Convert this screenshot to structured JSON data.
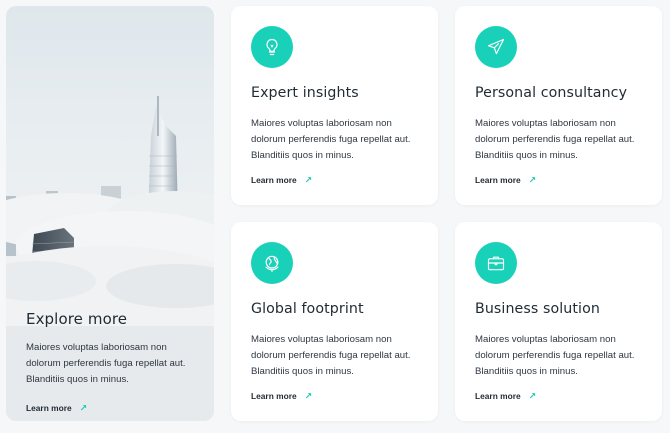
{
  "hero": {
    "title": "Explore more",
    "body": "Maiores voluptas laboriosam non dolorum perferendis fuga repellat aut. Blanditiis quos in minus.",
    "link": "Learn more"
  },
  "cards": [
    {
      "title": "Expert insights",
      "icon": "lightbulb-icon",
      "body": "Maiores voluptas laboriosam non dolorum perferendis fuga repellat aut. Blanditiis quos in minus.",
      "link": "Learn more"
    },
    {
      "title": "Personal consultancy",
      "icon": "paper-plane-icon",
      "body": "Maiores voluptas laboriosam non dolorum perferendis fuga repellat aut. Blanditiis quos in minus.",
      "link": "Learn more"
    },
    {
      "title": "Global footprint",
      "icon": "globe-icon",
      "body": "Maiores voluptas laboriosam non dolorum perferendis fuga repellat aut. Blanditiis quos in minus.",
      "link": "Learn more"
    },
    {
      "title": "Business solution",
      "icon": "briefcase-icon",
      "body": "Maiores voluptas laboriosam non dolorum perferendis fuga repellat aut. Blanditiis quos in minus.",
      "link": "Learn more"
    }
  ],
  "colors": {
    "accent": "#19d0b9",
    "card_background": "#ffffff",
    "page_background": "#f6f7f8",
    "text": "#1f2a33"
  }
}
